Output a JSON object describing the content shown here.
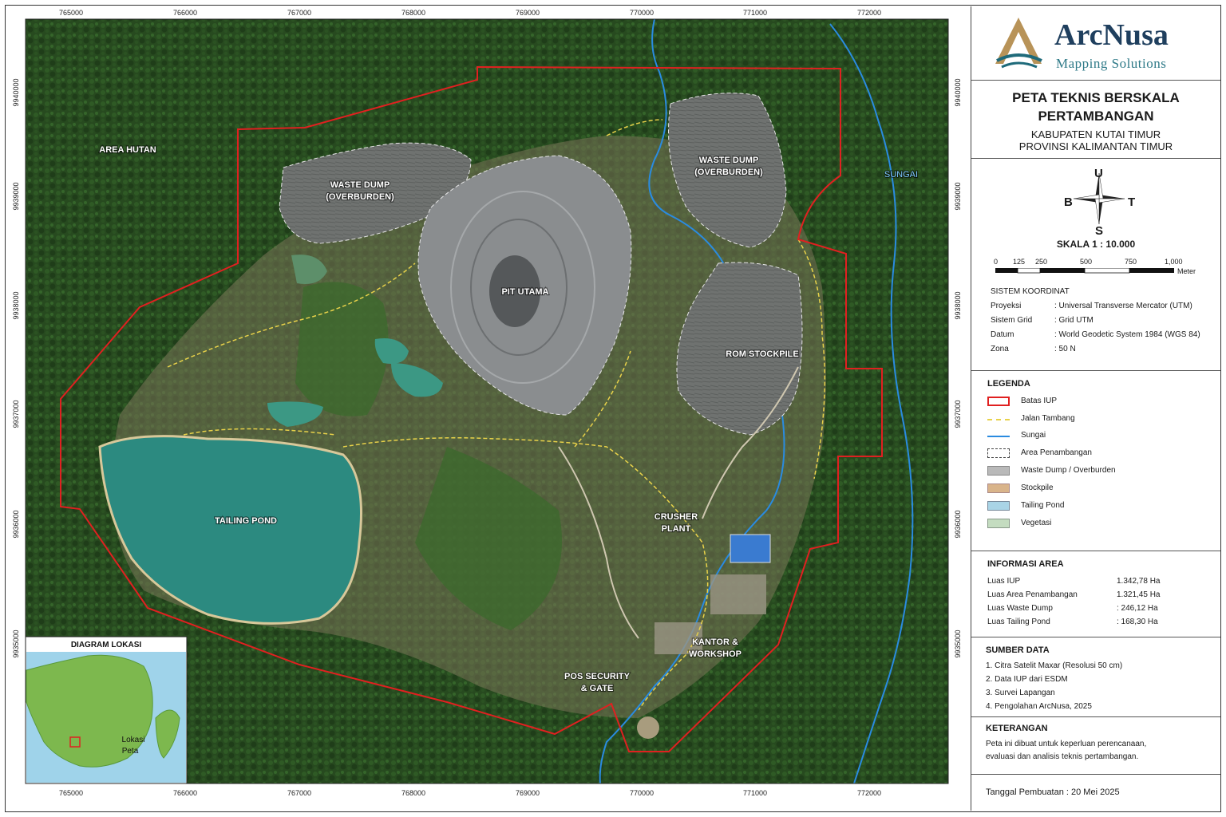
{
  "map": {
    "x_ticks": [
      "765000",
      "766000",
      "767000",
      "768000",
      "769000",
      "770000",
      "771000",
      "772000"
    ],
    "y_ticks": [
      "9940000",
      "9939000",
      "9938000",
      "9937000",
      "9936000",
      "9935000"
    ],
    "labels": {
      "area_hutan": "AREA HUTAN",
      "waste_dump_1a": "WASTE DUMP",
      "waste_dump_1b": "(OVERBURDEN)",
      "waste_dump_2a": "WASTE DUMP",
      "waste_dump_2b": "(OVERBURDEN)",
      "pit_utama": "PIT UTAMA",
      "rom_stockpile": "ROM STOCKPILE",
      "tailing_pond": "TAILING POND",
      "crusher_a": "CRUSHER",
      "crusher_b": "PLANT",
      "kantor_a": "KANTOR &",
      "kantor_b": "WORKSHOP",
      "pos_a": "POS SECURITY",
      "pos_b": "& GATE",
      "sungai": "SUNGAI"
    },
    "inset": {
      "title": "DIAGRAM LOKASI",
      "label_a": "Lokasi",
      "label_b": "Peta"
    }
  },
  "logo": {
    "name": "ArcNusa",
    "tagline": "Mapping Solutions"
  },
  "title": {
    "line1": "PETA TEKNIS BERSKALA",
    "line2": "PERTAMBANGAN",
    "line3": "KABUPATEN KUTAI TIMUR",
    "line4": "PROVINSI KALIMANTAN TIMUR"
  },
  "compass": {
    "north": "U",
    "south": "S",
    "east": "T",
    "west": "B"
  },
  "scale": {
    "label": "SKALA 1 : 10.000",
    "ticks": [
      "0",
      "125",
      "250",
      "500",
      "750",
      "1,000"
    ],
    "unit": "Meter"
  },
  "coord": {
    "title": "SISTEM KOORDINAT",
    "rows": [
      {
        "k": "Proyeksi",
        "v": ": Universal Transverse Mercator (UTM)"
      },
      {
        "k": "Sistem Grid",
        "v": ": Grid UTM"
      },
      {
        "k": "Datum",
        "v": ": World Geodetic System 1984 (WGS 84)"
      },
      {
        "k": "Zona",
        "v": ": 50 N"
      }
    ]
  },
  "legend": {
    "title": "LEGENDA",
    "items": [
      {
        "label": "Batas IUP",
        "color": "#e02020"
      },
      {
        "label": "Jalan Tambang",
        "color": "#e8d24a"
      },
      {
        "label": "Sungai",
        "color": "#2a8be0"
      },
      {
        "label": "Area Penambangan",
        "color": "#444444"
      },
      {
        "label": "Waste Dump / Overburden",
        "color": "#b9b9b9"
      },
      {
        "label": "Stockpile",
        "color": "#d9b48a"
      },
      {
        "label": "Tailing Pond",
        "color": "#a9d4e6"
      },
      {
        "label": "Vegetasi",
        "color": "#c4dcc0"
      }
    ]
  },
  "info": {
    "title": "INFORMASI AREA",
    "rows": [
      {
        "k": "Luas IUP",
        "v": "1.342,78 Ha"
      },
      {
        "k": "Luas Area Penambangan",
        "v": "1.321,45 Ha"
      },
      {
        "k": "Luas Waste Dump",
        "v": ": 246,12 Ha"
      },
      {
        "k": "Luas Tailing Pond",
        "v": ": 168,30 Ha"
      }
    ]
  },
  "sources": {
    "title": "SUMBER DATA",
    "rows": [
      "1. Citra Satelit Maxar (Resolusi 50 cm)",
      "2. Data IUP dari ESDM",
      "3. Survei Lapangan",
      "4. Pengolahan ArcNusa, 2025"
    ]
  },
  "notes": {
    "title": "KETERANGAN",
    "line1": "Peta ini dibuat untuk keperluan perencanaan,",
    "line2": "evaluasi dan analisis teknis pertambangan."
  },
  "date": "Tanggal Pembuatan : 20 Mei 2025"
}
